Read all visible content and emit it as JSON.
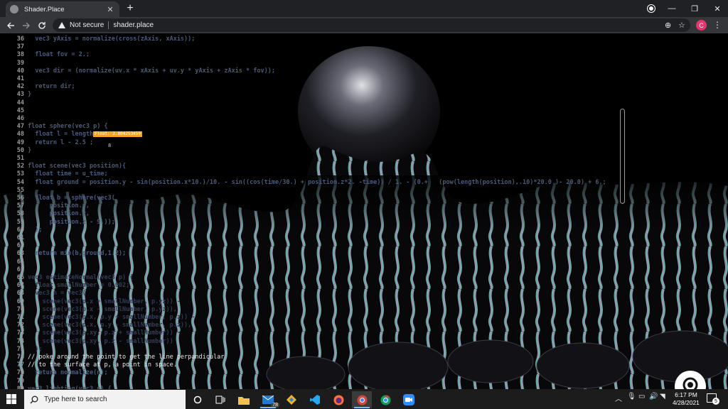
{
  "browser": {
    "tab_title": "Shader.Place",
    "tab_close": "✕",
    "new_tab": "+",
    "security_label": "Not secure",
    "url": "shader.place",
    "profile_initial": "C",
    "window_controls": {
      "minimize": "—",
      "restore": "❐",
      "close": "✕"
    }
  },
  "editor": {
    "lines": [
      {
        "n": "36",
        "text": "  vec3 yAxis = normalize(cross(zAxis, xAxis));"
      },
      {
        "n": "37",
        "text": ""
      },
      {
        "n": "38",
        "text": "  float fov = 2.;"
      },
      {
        "n": "39",
        "text": ""
      },
      {
        "n": "40",
        "text": "  vec3 dir = (normalize(uv.x * xAxis + uv.y * yAxis + zAxis * fov));"
      },
      {
        "n": "41",
        "text": ""
      },
      {
        "n": "42",
        "text": "  return dir;"
      },
      {
        "n": "43",
        "text": "}"
      },
      {
        "n": "44",
        "text": ""
      },
      {
        "n": "45",
        "text": ""
      },
      {
        "n": "46",
        "text": ""
      },
      {
        "n": "47",
        "text": "float sphere(vec3 p) {"
      },
      {
        "n": "48",
        "text": "  float l = length"
      },
      {
        "n": "49",
        "text": "  return l - 2.5 ;"
      },
      {
        "n": "50",
        "text": "}"
      },
      {
        "n": "51",
        "text": ""
      },
      {
        "n": "52",
        "text": "float scene(vec3 position){"
      },
      {
        "n": "53",
        "text": "  float time = u_time;"
      },
      {
        "n": "54",
        "text": "  float ground = position.y - sin(position.x*10.)/10. - sin((cos(time/30.) + position.z*2. -time)) / 1. - (0.+   (pow(length(position),.10)*20.0 )- 20.0) + 6.;"
      },
      {
        "n": "55",
        "text": ""
      },
      {
        "n": "56",
        "text": "  float b = sphere(vec3("
      },
      {
        "n": "57",
        "text": "      position.x,"
      },
      {
        "n": "58",
        "text": "      position.y,"
      },
      {
        "n": "59",
        "text": "      position.z - 9.));"
      },
      {
        "n": "60",
        "text": "  );"
      },
      {
        "n": "61",
        "text": ""
      },
      {
        "n": "62",
        "text": ""
      },
      {
        "n": "63",
        "text": "  return min(b,ground,1.2);"
      },
      {
        "n": "64",
        "text": ""
      },
      {
        "n": "65",
        "text": ""
      },
      {
        "n": "66",
        "text": "vec3 estimateNormal(vec3 p) {"
      },
      {
        "n": "67",
        "text": "  float smallNumber = 0.002;"
      },
      {
        "n": "68",
        "text": "  vec3 n = vec3("
      },
      {
        "n": "69",
        "text": "    scene(vec3(p.x + smallNumber, p.yz)) -"
      },
      {
        "n": "70",
        "text": "    scene(vec3(p.x - smallNumber, p.yz)),"
      },
      {
        "n": "71",
        "text": "    scene(vec3(p.x, p.y + smallNumber, p.z)) -"
      },
      {
        "n": "72",
        "text": "    scene(vec3(p.x, p.y - smallNumber, p.z)),"
      },
      {
        "n": "73",
        "text": "    scene(vec3(p.xy, p.z + smallNumber)) -"
      },
      {
        "n": "74",
        "text": "    scene(vec3(p.xy, p.z - smallNumber))"
      },
      {
        "n": "75",
        "text": "  );"
      },
      {
        "n": "76",
        "text": "// poke around the point to get the line perpandicular"
      },
      {
        "n": "77",
        "text": "// to the surface at p, a point in space."
      },
      {
        "n": "78",
        "text": "  return normalize(n);"
      },
      {
        "n": "79",
        "text": ""
      },
      {
        "n": "80",
        "text": "vec3 lighting(vec3 p) {"
      }
    ],
    "inline_value": "Float: 2.804253459",
    "cursor_mark": "8"
  },
  "taskbar": {
    "search_placeholder": "Type here to search",
    "mail_badge": "78",
    "time": "6:17 PM",
    "date": "4/28/2021",
    "notification_count": "5"
  },
  "colors": {
    "chrome_bg": "#202124",
    "toolbar_bg": "#35363a",
    "code_keyword": "#4b5a78",
    "tooltip": "#f4a324",
    "taskbar_bg": "#1c1c1c",
    "avatar": "#e8336c"
  }
}
